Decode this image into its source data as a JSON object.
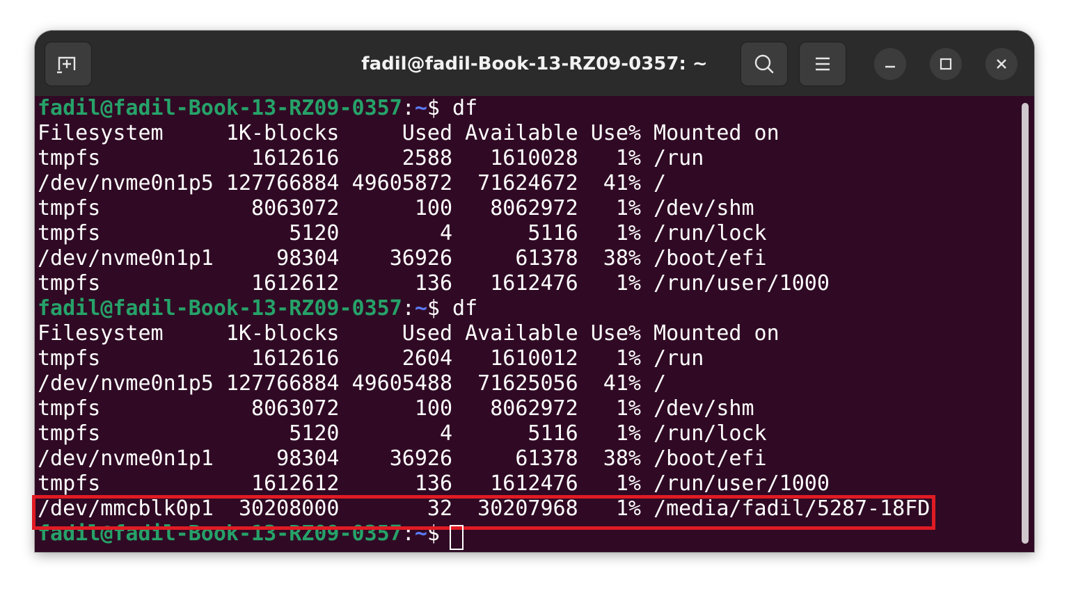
{
  "window": {
    "title": "fadil@fadil-Book-13-RZ09-0357: ~",
    "buttons": {
      "new_tab_icon": "new-tab-icon",
      "search_icon": "search-icon",
      "menu_icon": "hamburger-menu-icon",
      "minimize_icon": "minimize-icon",
      "maximize_icon": "maximize-icon",
      "close_icon": "close-icon"
    }
  },
  "terminal": {
    "prompt": {
      "user_host": "fadil@fadil-Book-13-RZ09-0357",
      "colon": ":",
      "path": "~",
      "symbol": "$ "
    },
    "command": "df",
    "blocks": [
      {
        "header": "Filesystem     1K-blocks     Used Available Use% Mounted on",
        "rows": [
          "tmpfs            1612616     2588   1610028   1% /run",
          "/dev/nvme0n1p5 127766884 49605872  71624672  41% /",
          "tmpfs            8063072      100   8062972   1% /dev/shm",
          "tmpfs               5120        4      5116   1% /run/lock",
          "/dev/nvme0n1p1     98304    36926     61378  38% /boot/efi",
          "tmpfs            1612612      136   1612476   1% /run/user/1000"
        ]
      },
      {
        "header": "Filesystem     1K-blocks     Used Available Use% Mounted on",
        "rows": [
          "tmpfs            1612616     2604   1610012   1% /run",
          "/dev/nvme0n1p5 127766884 49605488  71625056  41% /",
          "tmpfs            8063072      100   8062972   1% /dev/shm",
          "tmpfs               5120        4      5116   1% /run/lock",
          "/dev/nvme0n1p1     98304    36926     61378  38% /boot/efi",
          "tmpfs            1612612      136   1612476   1% /run/user/1000",
          "/dev/mmcblk0p1  30208000       32  30207968   1% /media/fadil/5287-18FD"
        ]
      }
    ]
  },
  "colors": {
    "terminal_bg": "#300a24",
    "prompt_user": "#26a269",
    "prompt_path": "#5c7cfa",
    "highlight": "#e01b24"
  }
}
